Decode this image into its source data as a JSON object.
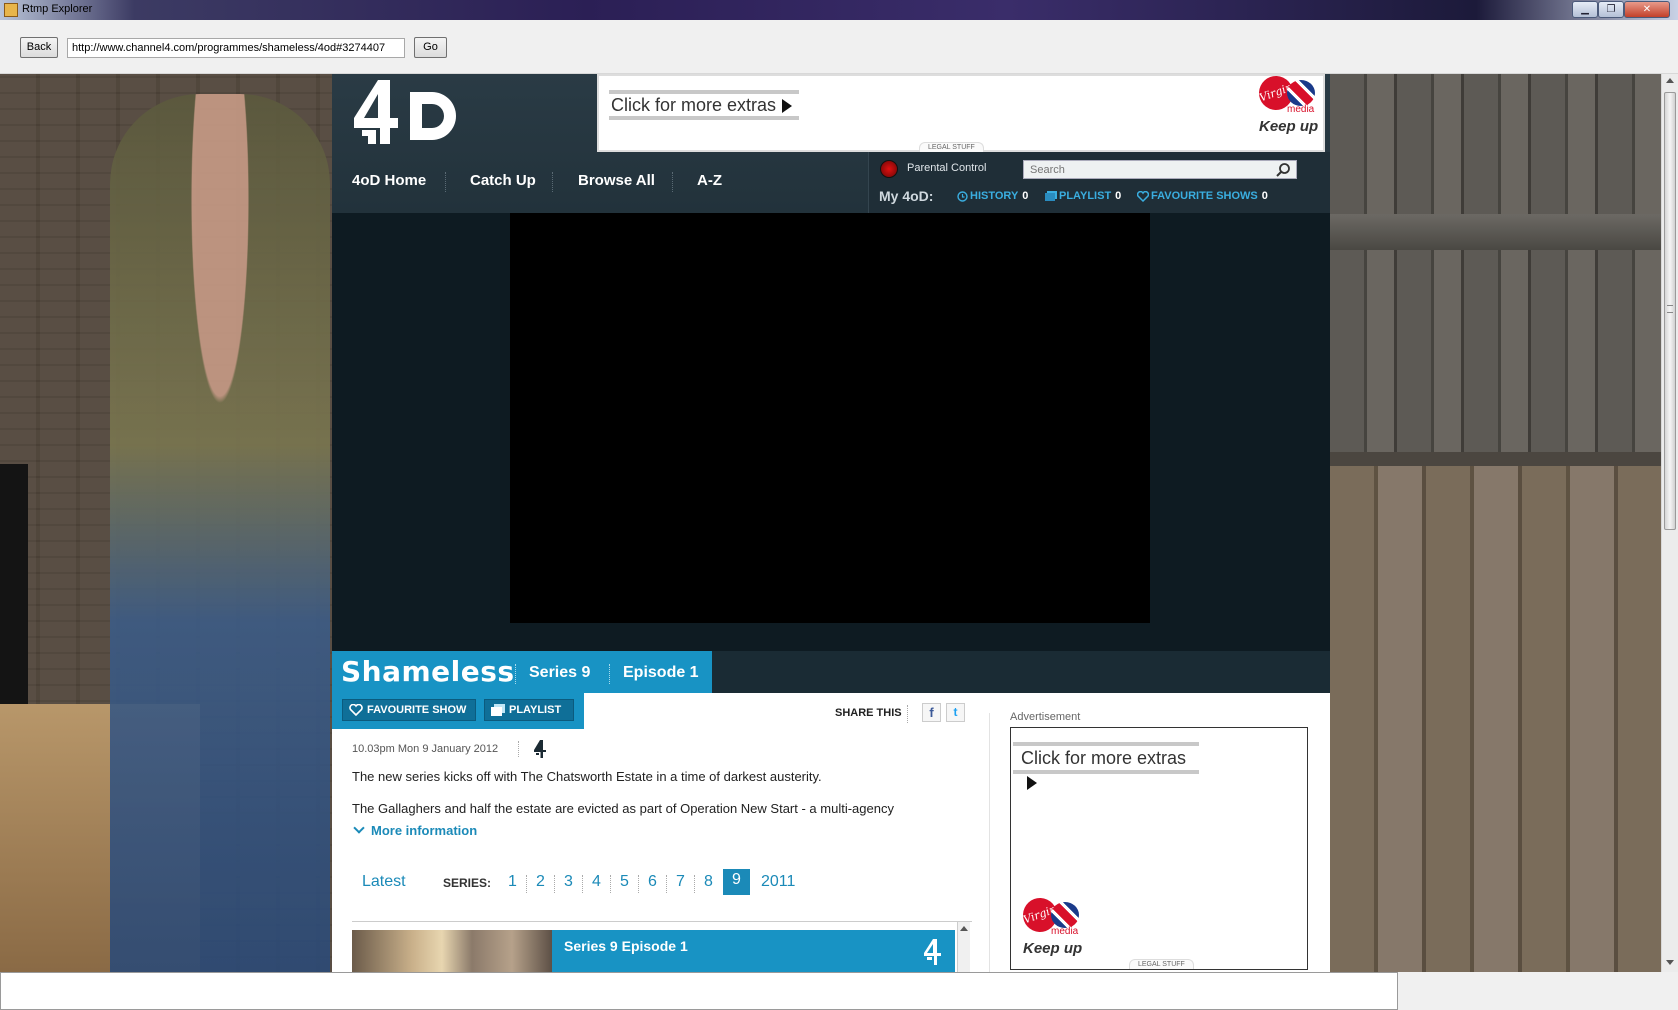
{
  "window": {
    "title": "Rtmp Explorer",
    "min_glyph": "▁",
    "max_glyph": "❐",
    "close_glyph": "✕"
  },
  "toolbar": {
    "back_label": "Back",
    "url_value": "http://www.channel4.com/programmes/shameless/4od#3274407",
    "go_label": "Go"
  },
  "ads": {
    "top": {
      "extras_text": "Click for more extras",
      "brand_media": "media",
      "brand_tagline": "Keep up",
      "brand_circle": "Virgin",
      "legal": "LEGAL STUFF"
    },
    "side": {
      "label": "Advertisement",
      "extras_text": "Click for more extras",
      "brand_media": "media",
      "brand_tagline": "Keep up",
      "brand_circle": "Virgin",
      "legal": "LEGAL STUFF"
    }
  },
  "nav": {
    "items": [
      {
        "label": "4oD Home"
      },
      {
        "label": "Catch Up"
      },
      {
        "label": "Browse All"
      },
      {
        "label": "A-Z"
      }
    ]
  },
  "my4od": {
    "parental_control": "Parental Control",
    "search_placeholder": "Search",
    "title": "My 4oD:",
    "history": {
      "label": "HISTORY",
      "count": "0"
    },
    "playlist": {
      "label": "PLAYLIST",
      "count": "0"
    },
    "favourites": {
      "label": "FAVOURITE SHOWS",
      "count": "0"
    }
  },
  "programme": {
    "title": "Shameless",
    "series": "Series 9",
    "episode": "Episode 1",
    "favourite_button": "FAVOURITE SHOW",
    "playlist_button": "PLAYLIST",
    "share_label": "SHARE THIS",
    "facebook_glyph": "f",
    "twitter_glyph": "t",
    "airdate": "10.03pm Mon 9 January 2012",
    "description_1": "The new series kicks off with The Chatsworth Estate in a time of darkest austerity.",
    "description_2": "The Gallaghers and half the estate are evicted as part of Operation New Start - a multi-agency",
    "more_info": "More information"
  },
  "series_nav": {
    "latest": "Latest",
    "label": "SERIES:",
    "items": [
      "1",
      "2",
      "3",
      "4",
      "5",
      "6",
      "7",
      "8",
      "9",
      "2011"
    ],
    "active": "9"
  },
  "episode_list": {
    "rows": [
      {
        "title": "Series 9 Episode 1"
      }
    ]
  },
  "colors": {
    "accent": "#1893c4",
    "link": "#1b8ab8",
    "header_dark": "#22323b"
  }
}
